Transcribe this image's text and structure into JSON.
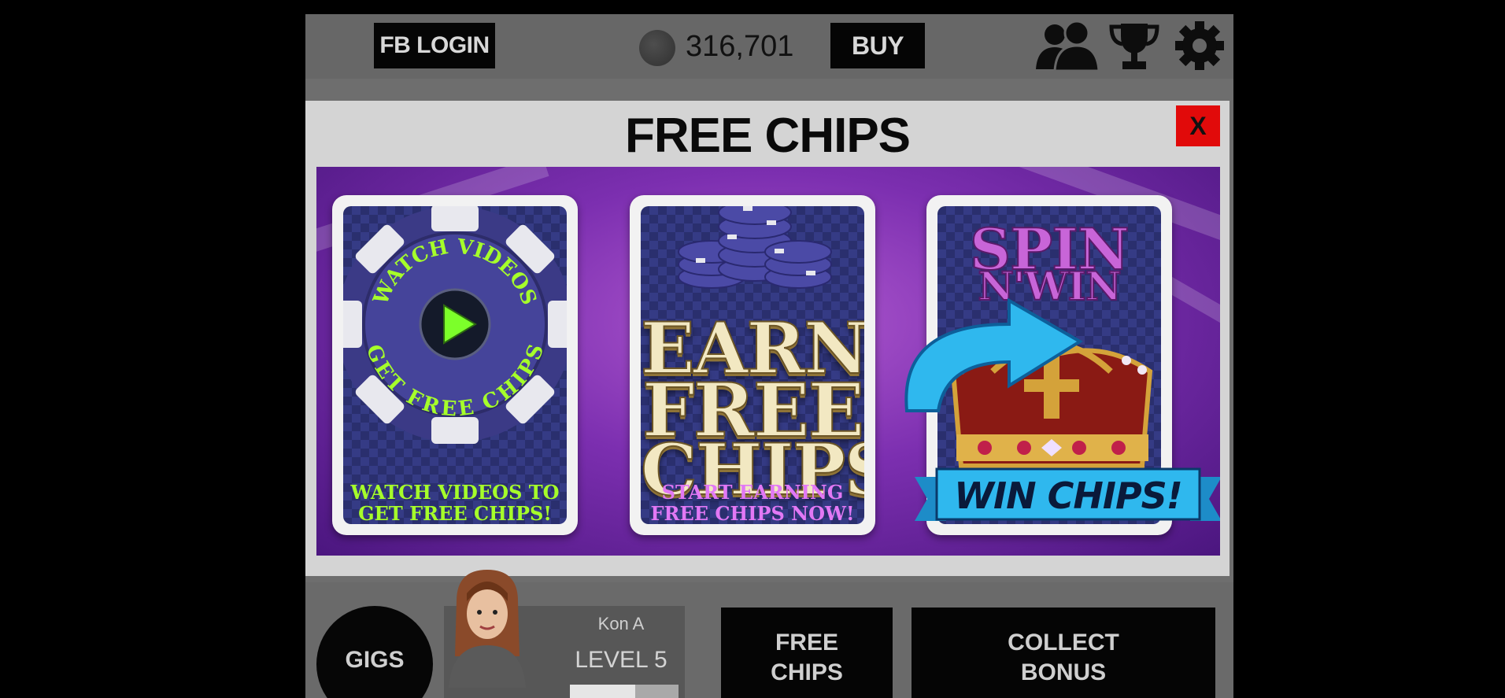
{
  "topbar": {
    "fb_login_label": "FB LOGIN",
    "chip_count": "316,701",
    "buy_label": "BUY",
    "icons": [
      "friends-icon",
      "trophy-icon",
      "gear-icon"
    ]
  },
  "dialog": {
    "title": "FREE CHIPS",
    "close_label": "X",
    "cards": [
      {
        "id": "watch-videos",
        "chip_text_top": "WATCH VIDEOS",
        "chip_text_bottom": "GET FREE CHIPS",
        "caption_line1": "WATCH VIDEOS TO",
        "caption_line2": "GET FREE CHIPS!"
      },
      {
        "id": "earn-free-chips",
        "title_line1": "EARN",
        "title_line2": "FREE",
        "title_line3": "CHIPS",
        "caption_line1": "START EARNING",
        "caption_line2": "FREE CHIPS NOW!"
      },
      {
        "id": "spin-n-win",
        "title_line1": "SPIN",
        "title_line2": "N'WIN",
        "ribbon_text": "WIN CHIPS!"
      }
    ]
  },
  "bottombar": {
    "gigs_label": "GIGS",
    "player_name": "Kon A",
    "player_level": "LEVEL 5",
    "level_progress": 0.6,
    "free_chips_line1": "FREE",
    "free_chips_line2": "CHIPS",
    "collect_line1": "COLLECT",
    "collect_line2": "BONUS"
  },
  "colors": {
    "close_red": "#e10a0a",
    "watch_caption_green": "#a6ff2a",
    "earn_caption_pink": "#e278f5",
    "banner_purple": "#7c2fb0",
    "ribbon_blue": "#2fb8ee"
  }
}
